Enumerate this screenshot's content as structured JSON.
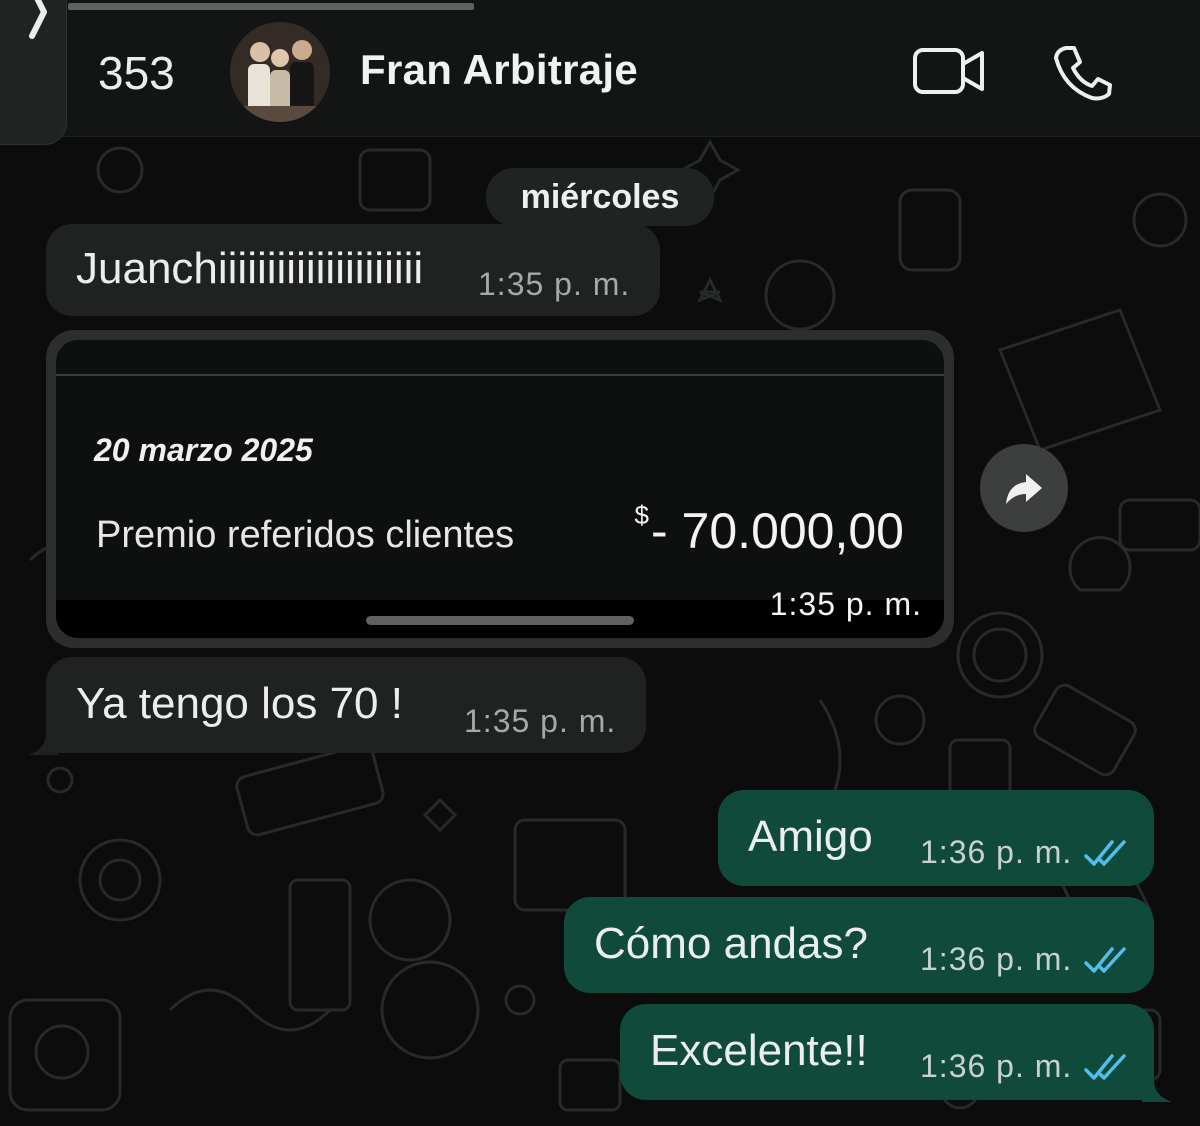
{
  "header": {
    "unread_count": "353",
    "contact_name": "Fran Arbitraje",
    "icons": [
      "back-chevron-icon",
      "video-call-icon",
      "phone-call-icon"
    ]
  },
  "date_chip": "miércoles",
  "messages": [
    {
      "direction": "incoming",
      "text": "Juanchiiiiiiiiiiiiiiiiiiiii",
      "time": "1:35 p. m."
    },
    {
      "direction": "incoming",
      "type": "image",
      "image_content": {
        "date": "20 marzo 2025",
        "description": "Premio referidos clientes",
        "currency": "$",
        "amount": "- 70.000,00"
      },
      "time": "1:35 p. m."
    },
    {
      "direction": "incoming",
      "text": "Ya tengo los 70 !",
      "time": "1:35 p. m."
    },
    {
      "direction": "outgoing",
      "text": "Amigo",
      "time": "1:36 p. m.",
      "status": "read"
    },
    {
      "direction": "outgoing",
      "text": "Cómo andas?",
      "time": "1:36 p. m.",
      "status": "read"
    },
    {
      "direction": "outgoing",
      "text": "Excelente!!",
      "time": "1:36 p. m.",
      "status": "read"
    }
  ],
  "colors": {
    "background": "#0b0c0b",
    "incoming_bubble": "#1f2220",
    "outgoing_bubble": "#0f4a3a",
    "read_ticks": "#53bdeb"
  }
}
